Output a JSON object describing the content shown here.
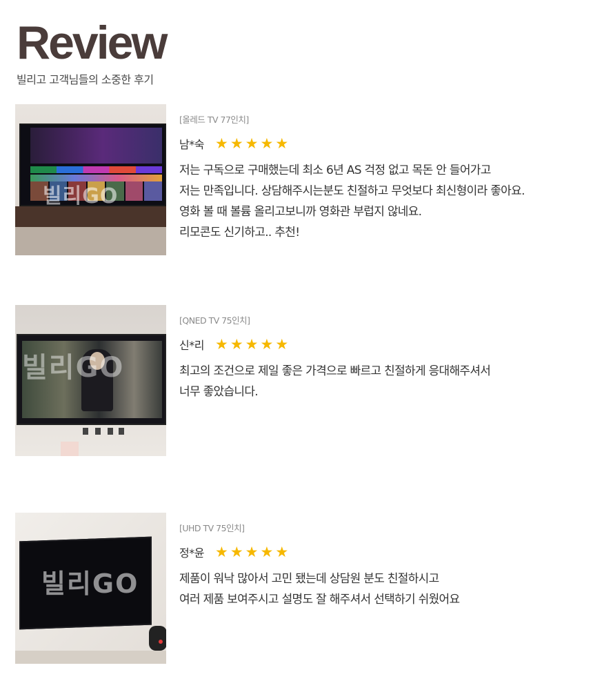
{
  "header": {
    "title": "Review",
    "subtitle": "빌리고 고객님들의 소중한 후기"
  },
  "reviews": [
    {
      "product": "[올레드 TV 77인치]",
      "name": "남*숙",
      "rating": 5,
      "lines": [
        "저는 구독으로 구매했는데 최소 6년 AS 걱정 없고 목돈 안 들어가고",
        "저는 만족입니다. 상담해주시는분도 친절하고 무엇보다 최신형이라 좋아요.",
        "영화 볼 때 볼륨 올리고보니까 영화관 부럽지 않네요.",
        "리모콘도 신기하고.. 추천!"
      ],
      "watermark": "빌리GO"
    },
    {
      "product": "[QNED TV 75인치]",
      "name": "신*리",
      "rating": 5,
      "lines": [
        "최고의 조건으로 제일 좋은 가격으로 빠르고 친절하게 응대해주셔서",
        "너무 좋았습니다."
      ],
      "watermark": "빌리GO"
    },
    {
      "product": "[UHD TV 75인치]",
      "name": "정*윤",
      "rating": 5,
      "lines": [
        "제품이 워낙 많아서 고민 됐는데 상담원 분도 친절하시고",
        "여러 제품 보여주시고 설명도 잘 해주셔서 선택하기 쉬웠어요"
      ],
      "watermark": "빌리GO"
    }
  ],
  "icons": {
    "star": "star-icon"
  },
  "colors": {
    "title": "#4a3c3a",
    "star": "#f6b800",
    "product_label": "#8a8a8a"
  }
}
